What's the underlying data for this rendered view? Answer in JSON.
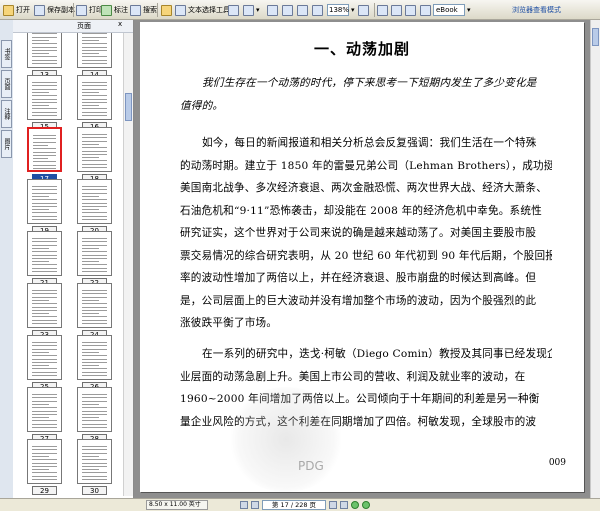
{
  "toolbar": {
    "open": "打开",
    "save_as": "保存副本",
    "print": "打印",
    "mark": "标注",
    "search": "搜索",
    "text_select": "文本选择工具",
    "zoom": "138%",
    "ebook": "eBook",
    "right_text": "浏览器查看模式"
  },
  "sidebar": {
    "tabs": [
      "书签",
      "页面",
      "注释",
      "图片"
    ],
    "panel_title": "页面",
    "close": "x"
  },
  "thumbnails": {
    "labels": [
      "13",
      "14",
      "15",
      "16",
      "17",
      "18",
      "19",
      "20",
      "21",
      "22",
      "23",
      "24",
      "25",
      "26",
      "27",
      "28",
      "29",
      "30"
    ],
    "selected_label": "17"
  },
  "document": {
    "chapter_title": "一、动荡加剧",
    "intro": [
      "我们生存在一个动荡的时代，停下来思考一下短期内发生了多少变化是",
      "值得的。"
    ],
    "para1": [
      "如今，每日的新闻报道和相关分析总会反复强调：我们生活在一个特殊",
      "的动荡时期。建立于 1850 年的雷曼兄弟公司（Lehman Brothers），成功挺过了",
      "美国南北战争、多次经济衰退、两次金融恐慌、两次世界大战、经济大萧条、",
      "石油危机和“9·11”恐怖袭击，却没能在 2008 年的经济危机中幸免。系统性",
      "研究证实，这个世界对于公司来说的确是越来越动荡了。对美国主要股市股",
      "票交易情况的综合研究表明，从 20 世纪 60 年代初到 90 年代后期，个股回报",
      "率的波动性增加了两倍以上，并在经济衰退、股市崩盘的时候达到高峰。但",
      "是，公司层面上的巨大波动并没有增加整个市场的波动，因为个股强烈的此",
      "涨彼跌平衡了市场。"
    ],
    "para2": [
      "在一系列的研究中，迭戈·柯敏（Diego Comin）教授及其同事已经发现企",
      "业层面的动荡急剧上升。美国上市公司的营收、利润及就业率的波动，在",
      "1960~2000 年间增加了两倍以上。公司倾向于十年期间的利差是另一种衡",
      "量企业风险的方式，这个利差在同期增加了四倍。柯敏发现，全球股市的波"
    ],
    "page_number": "009",
    "watermark": "PDG"
  },
  "statusbar": {
    "page_size": "8.50 x 11.00 英寸",
    "page_indicator": "第 17 / 228 页"
  }
}
